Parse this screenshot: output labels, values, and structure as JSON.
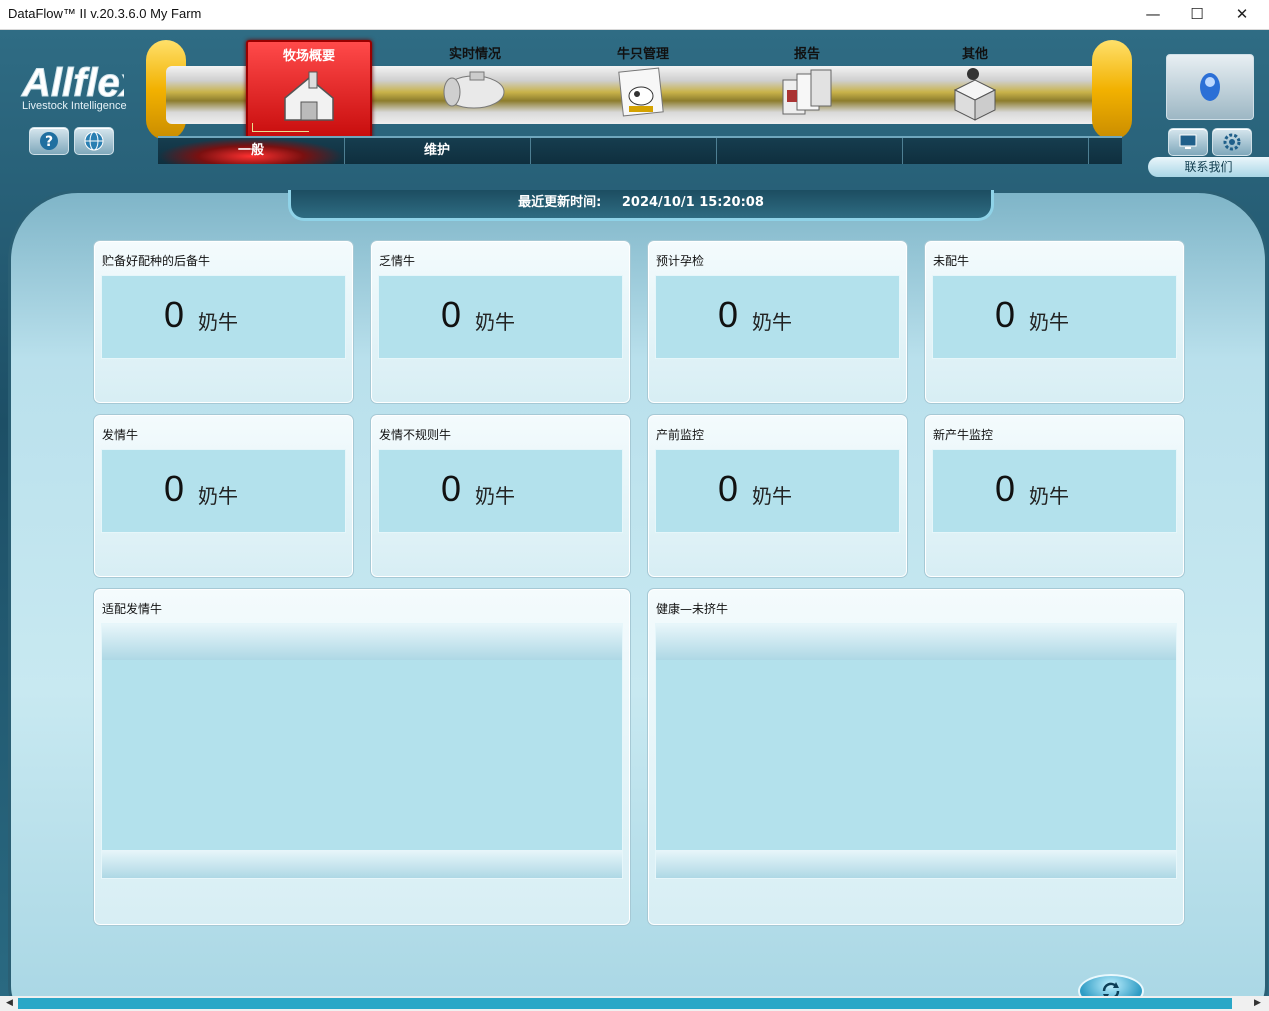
{
  "window": {
    "title": "DataFlow™ II v.20.3.6.0 My Farm",
    "minimize": "—",
    "maximize": "☐",
    "close": "✕"
  },
  "brand": {
    "logo_text": "Allflex",
    "tagline": "Livestock Intelligence"
  },
  "nav": {
    "tabs": [
      {
        "label": "牧场概要",
        "icon": "barn-icon",
        "active": true
      },
      {
        "label": "实时情况",
        "icon": "tank-icon",
        "active": false
      },
      {
        "label": "牛只管理",
        "icon": "cow-card-icon",
        "active": false
      },
      {
        "label": "报告",
        "icon": "reports-icon",
        "active": false
      },
      {
        "label": "其他",
        "icon": "box-icon",
        "active": false
      }
    ],
    "subtabs": [
      {
        "label": "一般",
        "active": true
      },
      {
        "label": "维护",
        "active": false
      },
      {
        "label": ""
      },
      {
        "label": ""
      },
      {
        "label": ""
      }
    ]
  },
  "contact": {
    "label": "联系我们"
  },
  "update": {
    "label": "最近更新时间:",
    "value": "2024/10/1 15:20:08"
  },
  "cards": [
    {
      "title": "贮备好配种的后备牛",
      "value": "0",
      "unit": "奶牛"
    },
    {
      "title": "乏情牛",
      "value": "0",
      "unit": "奶牛"
    },
    {
      "title": "预计孕检",
      "value": "0",
      "unit": "奶牛"
    },
    {
      "title": "未配牛",
      "value": "0",
      "unit": "奶牛"
    },
    {
      "title": "发情牛",
      "value": "0",
      "unit": "奶牛"
    },
    {
      "title": "发情不规则牛",
      "value": "0",
      "unit": "奶牛"
    },
    {
      "title": "产前监控",
      "value": "0",
      "unit": "奶牛"
    },
    {
      "title": "新产牛监控",
      "value": "0",
      "unit": "奶牛"
    }
  ],
  "lists": [
    {
      "title": "适配发情牛"
    },
    {
      "title": "健康—未挤牛"
    }
  ],
  "colors": {
    "active_tab": "#d01414",
    "accent": "#2aa7c7",
    "panel": "#b3e1ec"
  }
}
